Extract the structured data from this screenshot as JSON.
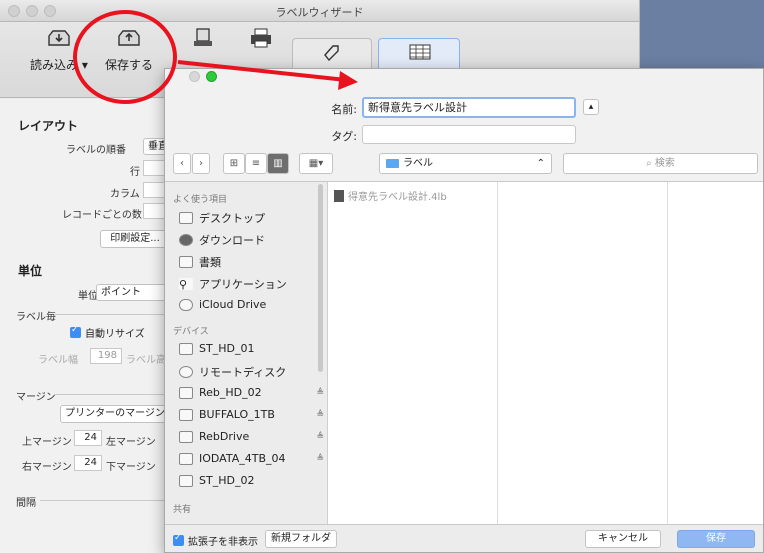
{
  "window": {
    "title": "ラベルウィザード"
  },
  "toolbar": {
    "load_label": "読み込み",
    "save_label": "保存する"
  },
  "layout": {
    "section": "レイアウト",
    "order_label": "ラベルの順番",
    "order_value": "垂直",
    "row_label": "行",
    "column_label": "カラム",
    "per_record_label": "レコードごとの数",
    "print_settings": "印刷設定..."
  },
  "units": {
    "section": "単位",
    "unit_label": "単位",
    "unit_value": "ポイント",
    "per_label": "ラベル毎",
    "auto_resize": "自動リサイズ",
    "label_width_label": "ラベル幅",
    "label_width_value": "198",
    "label_height_label": "ラベル高"
  },
  "margins": {
    "section": "マージン",
    "printer_btn": "プリンターのマージン",
    "top_label": "上マージン",
    "top_value": "24",
    "left_label": "左マージン",
    "right_label": "右マージン",
    "right_value": "24",
    "bottom_label": "下マージン",
    "spacing_label": "間隔"
  },
  "sheet": {
    "name_label": "名前:",
    "name_value": "新得意先ラベル設計",
    "tag_label": "タグ:",
    "location": "ラベル",
    "search_placeholder": "検索",
    "favorites_header": "よく使う項目",
    "favorites": [
      "デスクトップ",
      "ダウンロード",
      "書類",
      "アプリケーション",
      "iCloud Drive"
    ],
    "devices_header": "デバイス",
    "devices": [
      "ST_HD_01",
      "リモートディスク",
      "Reb_HD_02",
      "BUFFALO_1TB",
      "RebDrive",
      "IODATA_4TB_04",
      "ST_HD_02"
    ],
    "eject_glyph": "≜",
    "shared_header": "共有",
    "file_name": "得意先ラベル設計.4lb",
    "hide_ext": "拡張子を非表示",
    "new_folder": "新規フォルダ",
    "cancel": "キャンセル",
    "save": "保存"
  },
  "colors": {
    "annotation": "#e8131f",
    "accent": "#3d8df5"
  }
}
